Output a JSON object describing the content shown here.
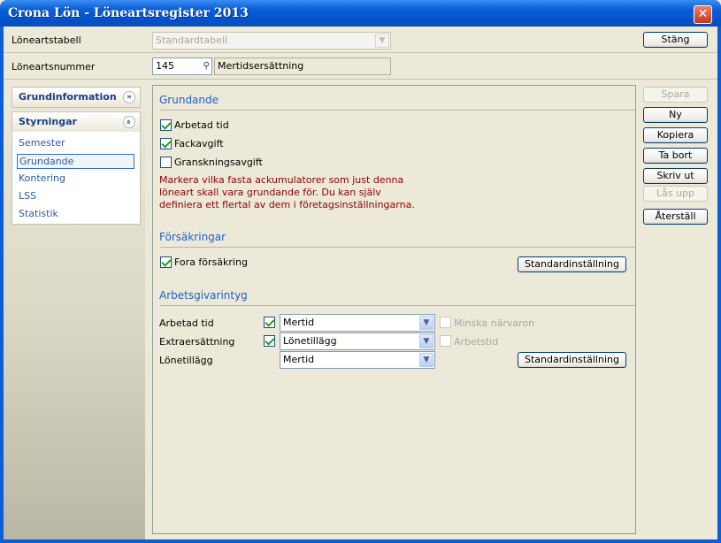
{
  "window": {
    "title": "Crona Lön - Löneartsregister 2013",
    "close_glyph": "✕"
  },
  "header": {
    "loneartstabell_label": "Löneartstabell",
    "loneartstabell_value": "Standardtabell",
    "close_button": "Stäng",
    "loneartsnummer_label": "Löneartsnummer",
    "loneartsnummer_value": "145",
    "lookup_icon": "binoculars-icon",
    "loneart_name": "Mertidsersättning"
  },
  "sidebar": {
    "panels": [
      {
        "title": "Grundinformation",
        "expanded": false
      },
      {
        "title": "Styrningar",
        "expanded": true
      }
    ],
    "items": [
      "Semester",
      "Grundande",
      "Kontering",
      "LSS",
      "Statistik"
    ],
    "selected": "Grundande"
  },
  "grundande": {
    "title": "Grundande",
    "checks": [
      {
        "label": "Arbetad tid",
        "checked": true
      },
      {
        "label": "Fackavgift",
        "checked": true
      },
      {
        "label": "Granskningsavgift",
        "checked": false
      }
    ],
    "note": "Markera vilka fasta ackumulatorer som just denna löneart skall vara grundande för. Du kan själv definiera ett flertal av dem i företagsinställningarna."
  },
  "forsakringar": {
    "title": "Försäkringar",
    "check_label": "Fora försäkring",
    "checked": true,
    "default_button": "Standardinställning"
  },
  "arbetsgivarintyg": {
    "title": "Arbetsgivarintyg",
    "rows": [
      {
        "label": "Arbetad tid",
        "checked": true,
        "value": "Mertid",
        "extra_label": "Minska närvaron"
      },
      {
        "label": "Extraersättning",
        "checked": true,
        "value": "Lönetillägg",
        "extra_label": "Arbetstid"
      },
      {
        "label": "Lönetillägg",
        "value": "Mertid"
      }
    ],
    "default_button": "Standardinställning"
  },
  "actions": [
    "Spara",
    "Ny",
    "Kopiera",
    "Ta bort",
    "Skriv ut",
    "Lås upp",
    "Återställ"
  ],
  "colors": {
    "accent": "#1b63c6",
    "note": "#8b0000",
    "titlebar": "#0a5fd8"
  }
}
